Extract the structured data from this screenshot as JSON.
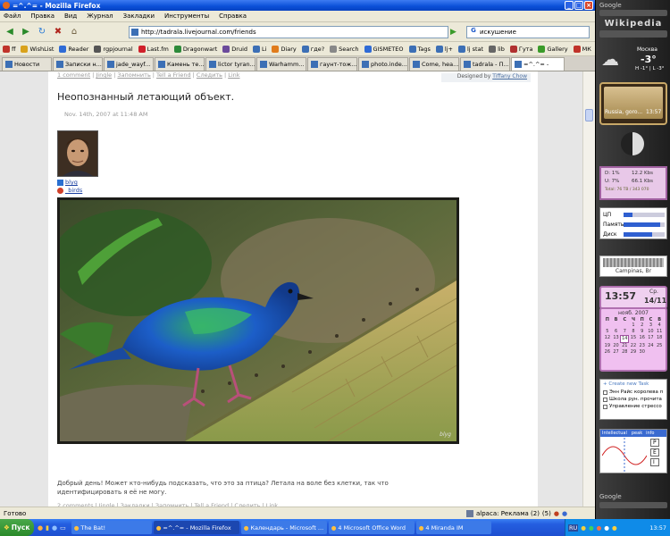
{
  "window": {
    "title": "=^.^= - Mozilla Firefox",
    "controls": [
      "_",
      "□",
      "×"
    ]
  },
  "menu": [
    "Файл",
    "Правка",
    "Вид",
    "Журнал",
    "Закладки",
    "Инструменты",
    "Справка"
  ],
  "nav": {
    "url": "http://tadrala.livejournal.com/friends",
    "search_engine": "G",
    "search_value": "искушение"
  },
  "bookmarks": [
    {
      "label": "ff",
      "color": "#c0332a"
    },
    {
      "label": "WishList",
      "color": "#d9a21b"
    },
    {
      "label": "Reader",
      "color": "#2f6bd6"
    },
    {
      "label": "rgpjournal",
      "color": "#555555"
    },
    {
      "label": "Last.fm",
      "color": "#d0202a"
    },
    {
      "label": "Dragonwart",
      "color": "#2d8a3a"
    },
    {
      "label": "Druid",
      "color": "#6b4a9b"
    },
    {
      "label": "Li",
      "color": "#3c6fb5"
    },
    {
      "label": "Diary",
      "color": "#e07b1c"
    },
    {
      "label": "где?",
      "color": "#3c6fb5"
    },
    {
      "label": "Search",
      "color": "#888888"
    },
    {
      "label": "GISMETEO",
      "color": "#2f6bd6"
    },
    {
      "label": "Tags",
      "color": "#3c6fb5"
    },
    {
      "label": "lj+",
      "color": "#3c6fb5"
    },
    {
      "label": "lj stat",
      "color": "#3c6fb5"
    },
    {
      "label": "lib",
      "color": "#666666"
    },
    {
      "label": "Гута",
      "color": "#b03030"
    },
    {
      "label": "Gallery",
      "color": "#3a9b2a"
    },
    {
      "label": "МК",
      "color": "#c0332a"
    }
  ],
  "tabs": [
    {
      "label": "Новости",
      "active": false
    },
    {
      "label": "Записки н...",
      "active": false
    },
    {
      "label": "jade_wayf...",
      "active": false
    },
    {
      "label": "Камень те...",
      "active": false
    },
    {
      "label": "lictor tyran...",
      "active": false
    },
    {
      "label": "Warhamm...",
      "active": false
    },
    {
      "label": "гаунт-тож...",
      "active": false
    },
    {
      "label": "photo.inde...",
      "active": false
    },
    {
      "label": "Come, hea...",
      "active": false
    },
    {
      "label": "tadrala - П...",
      "active": false
    },
    {
      "label": "=^.^= -",
      "active": true
    }
  ],
  "post": {
    "top_links": [
      "1 comment",
      "Jingle",
      "Запомнить",
      "Tell a Friend",
      "Следить",
      "Link"
    ],
    "designed_prefix": "Designed by",
    "designed_author": "Tiffany Chow",
    "title": "Неопознанный летающий объект.",
    "date": "Nov. 14th, 2007 at 11:48 AM",
    "user": "blyg",
    "community": "_birds",
    "caption": "Добрый день! Может кто-нибудь подсказать, что это за птица? Летала на воле без клетки, так что идентифицировать я её не могу.",
    "bottom_links": [
      "2 comments",
      "Jingle",
      "Закладки",
      "Запомнить",
      "Tell a Friend",
      "Следить",
      "Link"
    ],
    "watermark": "blyg"
  },
  "status": {
    "text": "Готово",
    "right": "alpaca: Реклама (2)",
    "count": "(5)"
  },
  "taskbar": {
    "start": "Пуск",
    "items": [
      "The Bat!",
      "=^.^= - Mozilla Firefox",
      "Календарь - Microsoft ...",
      "4 Microsoft Office Word",
      "4 Miranda IM"
    ],
    "lang": "RU",
    "time": "13:57"
  },
  "sidebar": {
    "google_logo": "Google",
    "wiki_logo": "Wikipedia",
    "weather_city": "Москва",
    "weather_temp": "-3°",
    "weather_range": "H -1° | L -3°",
    "clock_label": "Russia, goro...",
    "clock_time": "13:57",
    "net": {
      "down": "D: 1%",
      "down_rate": "12.2 Kbs",
      "up": "U: 7%",
      "up_rate": "66.1 Kbs",
      "total": "Total: 76 TB / 343 070"
    },
    "cpu_label": "ЦП",
    "mem_label": "Память",
    "disk_label": "Диск",
    "cpu_pct": 0.22,
    "mem_pct": 0.9,
    "disk_pct": 0.7,
    "location": "Campinas, Br",
    "time_big": "13:57",
    "weekday": "Ср.",
    "date_short": "14/11",
    "month": "нояб. 2007",
    "cal_header": [
      "П",
      "В",
      "С",
      "Ч",
      "П",
      "С",
      "В"
    ],
    "cal_days": [
      "",
      "",
      "",
      "1",
      "2",
      "3",
      "4",
      "5",
      "6",
      "7",
      "8",
      "9",
      "10",
      "11",
      "12",
      "13",
      "14",
      "15",
      "16",
      "17",
      "18",
      "19",
      "20",
      "21",
      "22",
      "23",
      "24",
      "25",
      "26",
      "27",
      "28",
      "29",
      "30",
      "",
      ""
    ],
    "tasks_header": "Create new Task",
    "tasks": [
      "Энн Райс королева п",
      "Школа рун. прочита",
      "Управление стрессо"
    ],
    "tabs2": [
      "Intellectual",
      "peak",
      "info"
    ],
    "side_letters": [
      "P",
      "E",
      "I"
    ],
    "google_bottom": "Google"
  }
}
